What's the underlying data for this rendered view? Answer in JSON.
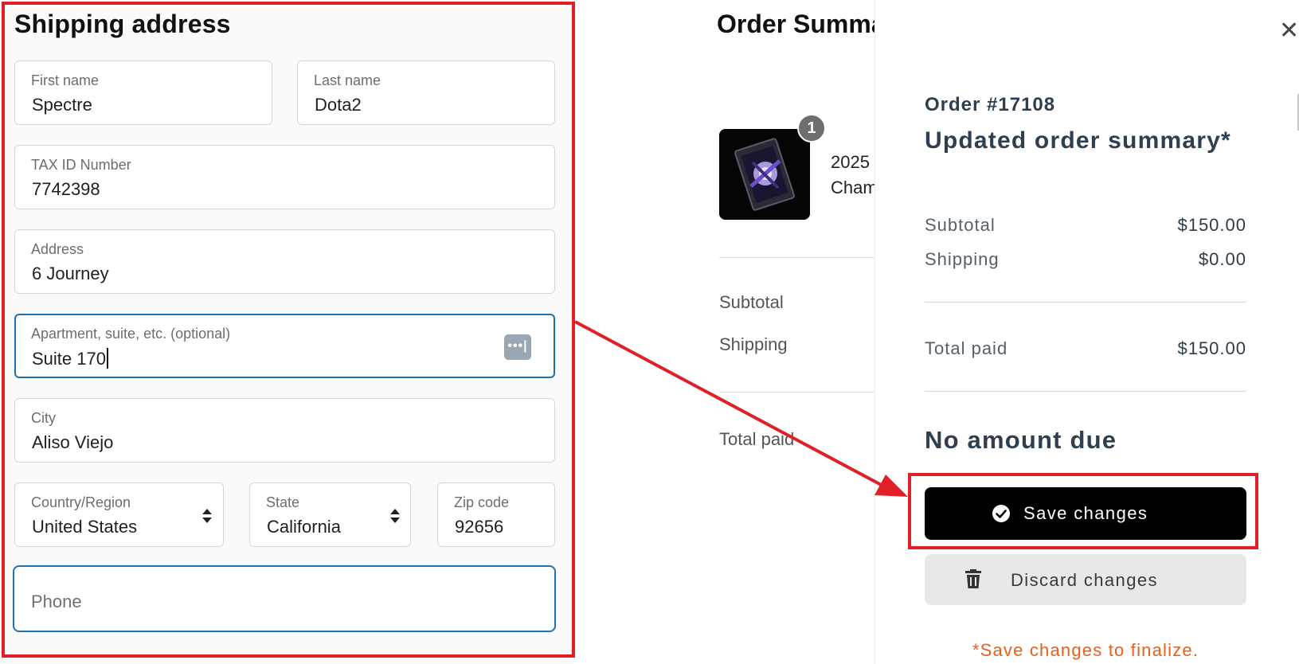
{
  "shipping": {
    "title": "Shipping address",
    "first_name": {
      "label": "First name",
      "value": "Spectre"
    },
    "last_name": {
      "label": "Last name",
      "value": "Dota2"
    },
    "tax_id": {
      "label": "TAX ID Number",
      "value": "7742398"
    },
    "address": {
      "label": "Address",
      "value": "6 Journey"
    },
    "apartment": {
      "label": "Apartment, suite, etc. (optional)",
      "value": "Suite 170",
      "autofill_icon": "password-manager-icon"
    },
    "city": {
      "label": "City",
      "value": "Aliso Viejo"
    },
    "country": {
      "label": "Country/Region",
      "value": "United States"
    },
    "state": {
      "label": "State",
      "value": "California"
    },
    "zip": {
      "label": "Zip code",
      "value": "92656"
    },
    "phone": {
      "placeholder": "Phone",
      "value": ""
    }
  },
  "summary": {
    "title": "Order Summa",
    "quantity_badge": "1",
    "product_line1": "2025",
    "product_line2": "Cham",
    "subtotal_label": "Subtotal",
    "shipping_label": "Shipping",
    "total_label": "Total paid"
  },
  "panel": {
    "close_icon": "close-icon",
    "order_number": "Order #17108",
    "title": "Updated order summary*",
    "subtotal_label": "Subtotal",
    "subtotal_value": "$150.00",
    "shipping_label": "Shipping",
    "shipping_value": "$0.00",
    "total_label": "Total paid",
    "total_value": "$150.00",
    "no_amount_due": "No amount due",
    "save_button": "Save changes",
    "discard_button": "Discard changes",
    "finalize_note": "*Save changes to finalize."
  },
  "colors": {
    "annotation": "#e21f26",
    "focus_border": "#1f6fb2",
    "heading": "#2f3f4f",
    "primary_button": "#000000",
    "secondary_button": "#e8e8e8",
    "note": "#e8611a"
  }
}
